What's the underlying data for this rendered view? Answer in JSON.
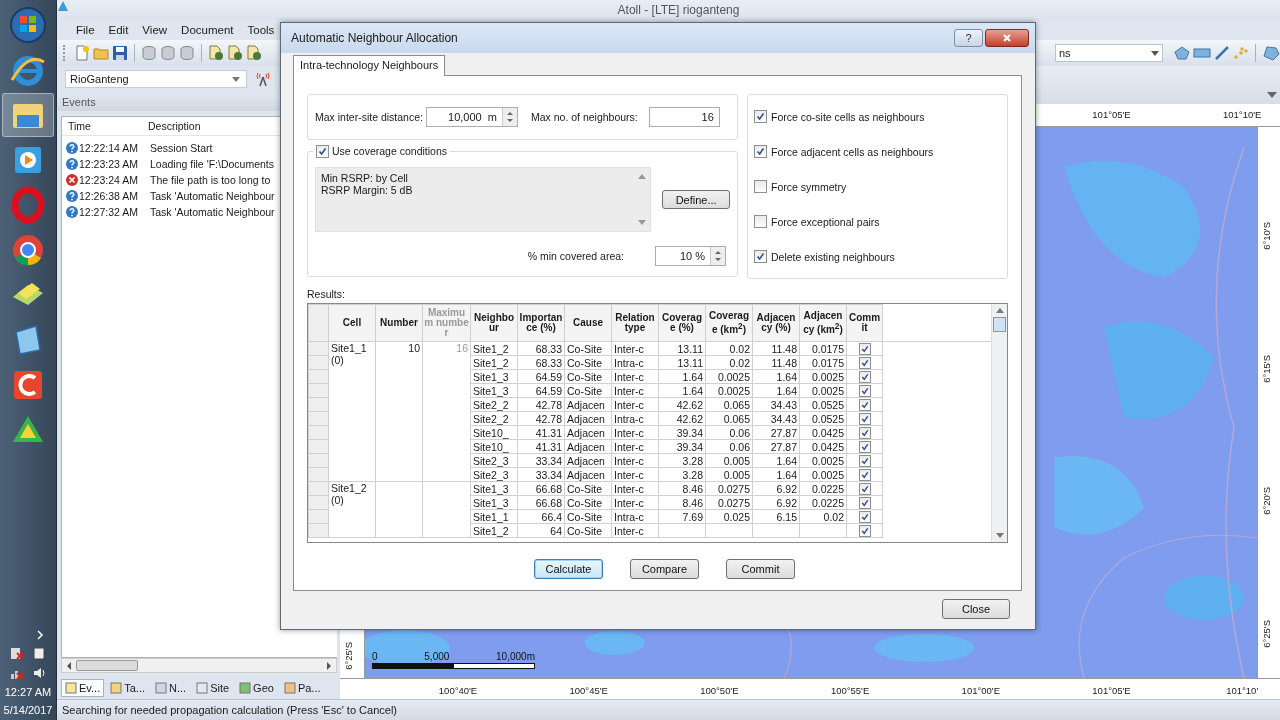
{
  "taskbar": {
    "clock": {
      "time": "12:27 AM",
      "date": "5/14/2017"
    }
  },
  "app": {
    "title": "Atoll - [LTE] rioganteng",
    "menu": [
      "File",
      "Edit",
      "View",
      "Document",
      "Tools"
    ],
    "toolbar_combo": {
      "value": "ns"
    }
  },
  "explorer": {
    "combo": {
      "value": "RioGanteng"
    }
  },
  "events": {
    "title": "Events",
    "columns": [
      "Time",
      "Description"
    ],
    "rows": [
      {
        "kind": "info",
        "time": "12:22:14 AM",
        "description": "Session Start"
      },
      {
        "kind": "info",
        "time": "12:23:23 AM",
        "description": "Loading file 'F:\\Documents"
      },
      {
        "kind": "error",
        "time": "12:23:24 AM",
        "description": "The file path is too long to"
      },
      {
        "kind": "info",
        "time": "12:26:38 AM",
        "description": "Task 'Automatic Neighbour"
      },
      {
        "kind": "info",
        "time": "12:27:32 AM",
        "description": "Task 'Automatic Neighbour"
      }
    ]
  },
  "panel_tabs": [
    {
      "label": "Ev...",
      "selected": true
    },
    {
      "label": "Ta...",
      "selected": false
    },
    {
      "label": "N...",
      "selected": false
    },
    {
      "label": "Site",
      "selected": false
    },
    {
      "label": "Geo",
      "selected": false
    },
    {
      "label": "Pa...",
      "selected": false
    }
  ],
  "map": {
    "top_ruler": [
      "101°05'E",
      "101°10'E"
    ],
    "bottom_ruler": [
      "100°40'E",
      "100°45'E",
      "100°50'E",
      "100°55'E",
      "101°00'E",
      "101°05'E",
      "101°10'"
    ],
    "left_ruler": [
      "6°25'S"
    ],
    "right_ruler": [
      "6°10'S",
      "6°15'S",
      "6°20'S",
      "6°25'S"
    ],
    "scale_bar": [
      "0",
      "5,000",
      "10,000m"
    ]
  },
  "dialog": {
    "title": "Automatic Neighbour Allocation",
    "help_button": "?",
    "tabs": [
      {
        "label": "Intra-technology Neighbours",
        "selected": true
      }
    ],
    "max_distance": {
      "label": "Max inter-site distance:",
      "value": "10,000  m"
    },
    "max_neighbours": {
      "label": "Max no. of neighbours:",
      "value": "16"
    },
    "coverage": {
      "label": "Use coverage conditions",
      "checked": true,
      "summary": [
        "Min RSRP: by Cell",
        "RSRP Margin: 5 dB"
      ],
      "define_button": "Define...",
      "min_area": {
        "label": "% min covered area:",
        "value": "10 %"
      }
    },
    "options": [
      {
        "label": "Force co-site cells as neighbours",
        "checked": true
      },
      {
        "label": "Force adjacent cells as neighbours",
        "checked": true
      },
      {
        "label": "Force symmetry",
        "checked": false
      },
      {
        "label": "Force exceptional pairs",
        "checked": false
      },
      {
        "label": "Delete existing neighbours",
        "checked": true
      }
    ],
    "results": {
      "label": "Results:",
      "columns": [
        {
          "label": "Cell",
          "disabled": false
        },
        {
          "label": "Number",
          "disabled": false
        },
        {
          "label": "Maximum number",
          "disabled": true
        },
        {
          "label": "Neighbour",
          "disabled": false
        },
        {
          "label": "Importance (%)",
          "disabled": false
        },
        {
          "label": "Cause",
          "disabled": false
        },
        {
          "label": "Relation type",
          "disabled": false
        },
        {
          "label": "Coverage (%)",
          "disabled": false
        },
        {
          "label": "Coverage (km$^{2}$)",
          "disabled": false
        },
        {
          "label": "Adjacency (%)",
          "disabled": false
        },
        {
          "label": "Adjacency (km$^{2}$)",
          "disabled": false
        },
        {
          "label": "Commit",
          "disabled": false
        }
      ],
      "groups": [
        {
          "cell": "Site1_1 (0)",
          "number": "10",
          "maximum": "16",
          "rows": [
            {
              "neighbour": "Site1_2",
              "cells": [
                "68.33",
                "Co-Site",
                "Inter-c",
                "13.11",
                "0.02",
                "11.48",
                "0.0175"
              ],
              "commit": true
            },
            {
              "neighbour": "Site1_2",
              "cells": [
                "68.33",
                "Co-Site",
                "Intra-c",
                "13.11",
                "0.02",
                "11.48",
                "0.0175"
              ],
              "commit": true
            },
            {
              "neighbour": "Site1_3",
              "cells": [
                "64.59",
                "Co-Site",
                "Inter-c",
                "1.64",
                "0.0025",
                "1.64",
                "0.0025"
              ],
              "commit": true
            },
            {
              "neighbour": "Site1_3",
              "cells": [
                "64.59",
                "Co-Site",
                "Inter-c",
                "1.64",
                "0.0025",
                "1.64",
                "0.0025"
              ],
              "commit": true
            },
            {
              "neighbour": "Site2_2",
              "cells": [
                "42.78",
                "Adjacen",
                "Inter-c",
                "42.62",
                "0.065",
                "34.43",
                "0.0525"
              ],
              "commit": true
            },
            {
              "neighbour": "Site2_2",
              "cells": [
                "42.78",
                "Adjacen",
                "Intra-c",
                "42.62",
                "0.065",
                "34.43",
                "0.0525"
              ],
              "commit": true
            },
            {
              "neighbour": "Site10_",
              "cells": [
                "41.31",
                "Adjacen",
                "Inter-c",
                "39.34",
                "0.06",
                "27.87",
                "0.0425"
              ],
              "commit": true
            },
            {
              "neighbour": "Site10_",
              "cells": [
                "41.31",
                "Adjacen",
                "Inter-c",
                "39.34",
                "0.06",
                "27.87",
                "0.0425"
              ],
              "commit": true
            },
            {
              "neighbour": "Site2_3",
              "cells": [
                "33.34",
                "Adjacen",
                "Inter-c",
                "3.28",
                "0.005",
                "1.64",
                "0.0025"
              ],
              "commit": true
            },
            {
              "neighbour": "Site2_3",
              "cells": [
                "33.34",
                "Adjacen",
                "Inter-c",
                "3.28",
                "0.005",
                "1.64",
                "0.0025"
              ],
              "commit": true
            }
          ]
        },
        {
          "cell": "Site1_2 (0)",
          "rows": [
            {
              "neighbour": "Site1_3",
              "cells": [
                "66.68",
                "Co-Site",
                "Inter-c",
                "8.46",
                "0.0275",
                "6.92",
                "0.0225"
              ],
              "commit": true
            },
            {
              "neighbour": "Site1_3",
              "cells": [
                "66.68",
                "Co-Site",
                "Inter-c",
                "8.46",
                "0.0275",
                "6.92",
                "0.0225"
              ],
              "commit": true
            },
            {
              "neighbour": "Site1_1",
              "cells": [
                "66.4",
                "Co-Site",
                "Intra-c",
                "7.69",
                "0.025",
                "6.15",
                "0.02"
              ],
              "commit": true
            },
            {
              "neighbour": "Site1_2",
              "cells": [
                "64",
                "Co-Site",
                "Inter-c"
              ],
              "commit": true
            }
          ]
        }
      ]
    },
    "buttons": [
      {
        "label": "Calculate",
        "default": true
      },
      {
        "label": "Compare",
        "default": false
      },
      {
        "label": "Commit",
        "default": false
      }
    ],
    "close_button": "Close"
  },
  "status_bar": {
    "text": "Searching for needed propagation calculation (Press 'Esc' to Cancel)"
  }
}
